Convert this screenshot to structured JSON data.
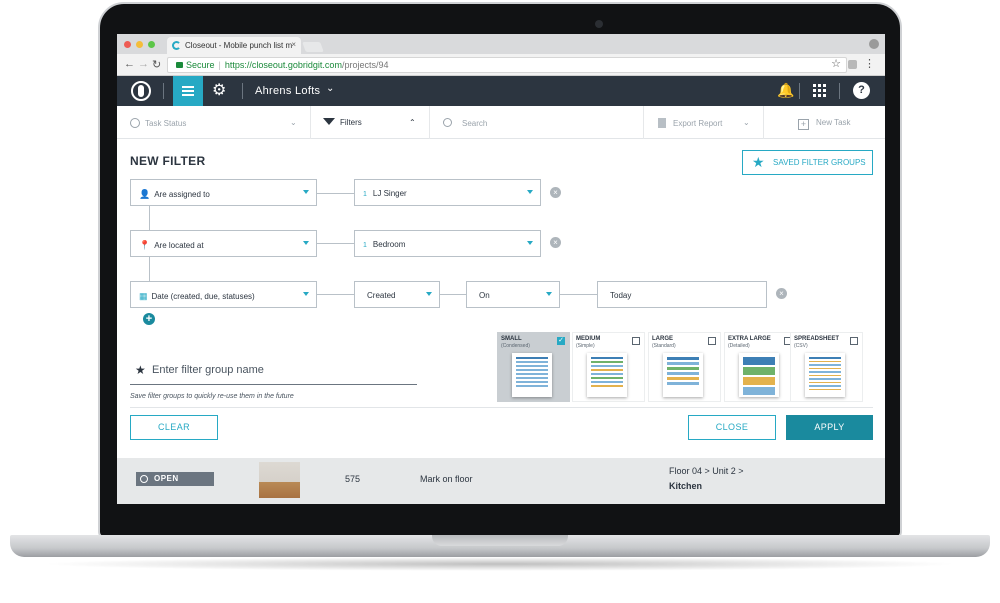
{
  "browser": {
    "tab_title": "Closeout - Mobile punch list m",
    "tab_close": "×",
    "secure_label": "Secure",
    "url_scheme": "https://",
    "url_host": "closeout.gobridgit.com",
    "url_path": "/projects/94"
  },
  "header": {
    "project_name": "Ahrens Lofts"
  },
  "toolbar": {
    "task_status": "Task Status",
    "filters": "Filters",
    "search_placeholder": "Search",
    "export_report": "Export Report",
    "new_task": "New Task"
  },
  "filter": {
    "title": "NEW FILTER",
    "saved_groups_button": "SAVED FILTER GROUPS",
    "rows": [
      {
        "field": "Are assigned to",
        "value_count": "1",
        "value": "LJ Singer"
      },
      {
        "field": "Are located at",
        "value_count": "1",
        "value": "Bedroom"
      },
      {
        "field": "Date (created, due, statuses)",
        "qualifier": "Created",
        "operator": "On",
        "date_value": "Today"
      }
    ],
    "group_name_placeholder": "Enter filter group name",
    "group_name_hint": "Save filter groups to quickly re-use them in the future",
    "report_sizes": [
      {
        "label": "SMALL",
        "sub": "(Condensed)",
        "selected": true
      },
      {
        "label": "MEDIUM",
        "sub": "(Simple)",
        "selected": false
      },
      {
        "label": "LARGE",
        "sub": "(Standard)",
        "selected": false
      },
      {
        "label": "EXTRA LARGE",
        "sub": "(Detailed)",
        "selected": false
      },
      {
        "label": "SPREADSHEET",
        "sub": "(CSV)",
        "selected": false
      }
    ],
    "clear_button": "CLEAR",
    "close_button": "CLOSE",
    "apply_button": "APPLY"
  },
  "task": {
    "status": "OPEN",
    "number": "575",
    "name": "Mark on floor",
    "location_path": "Floor 04 > Unit 2 >",
    "location_room": "Kitchen"
  },
  "colors": {
    "accent": "#27a9c4",
    "header_bg": "#2c3540",
    "apply_bg": "#1a8a9e"
  }
}
